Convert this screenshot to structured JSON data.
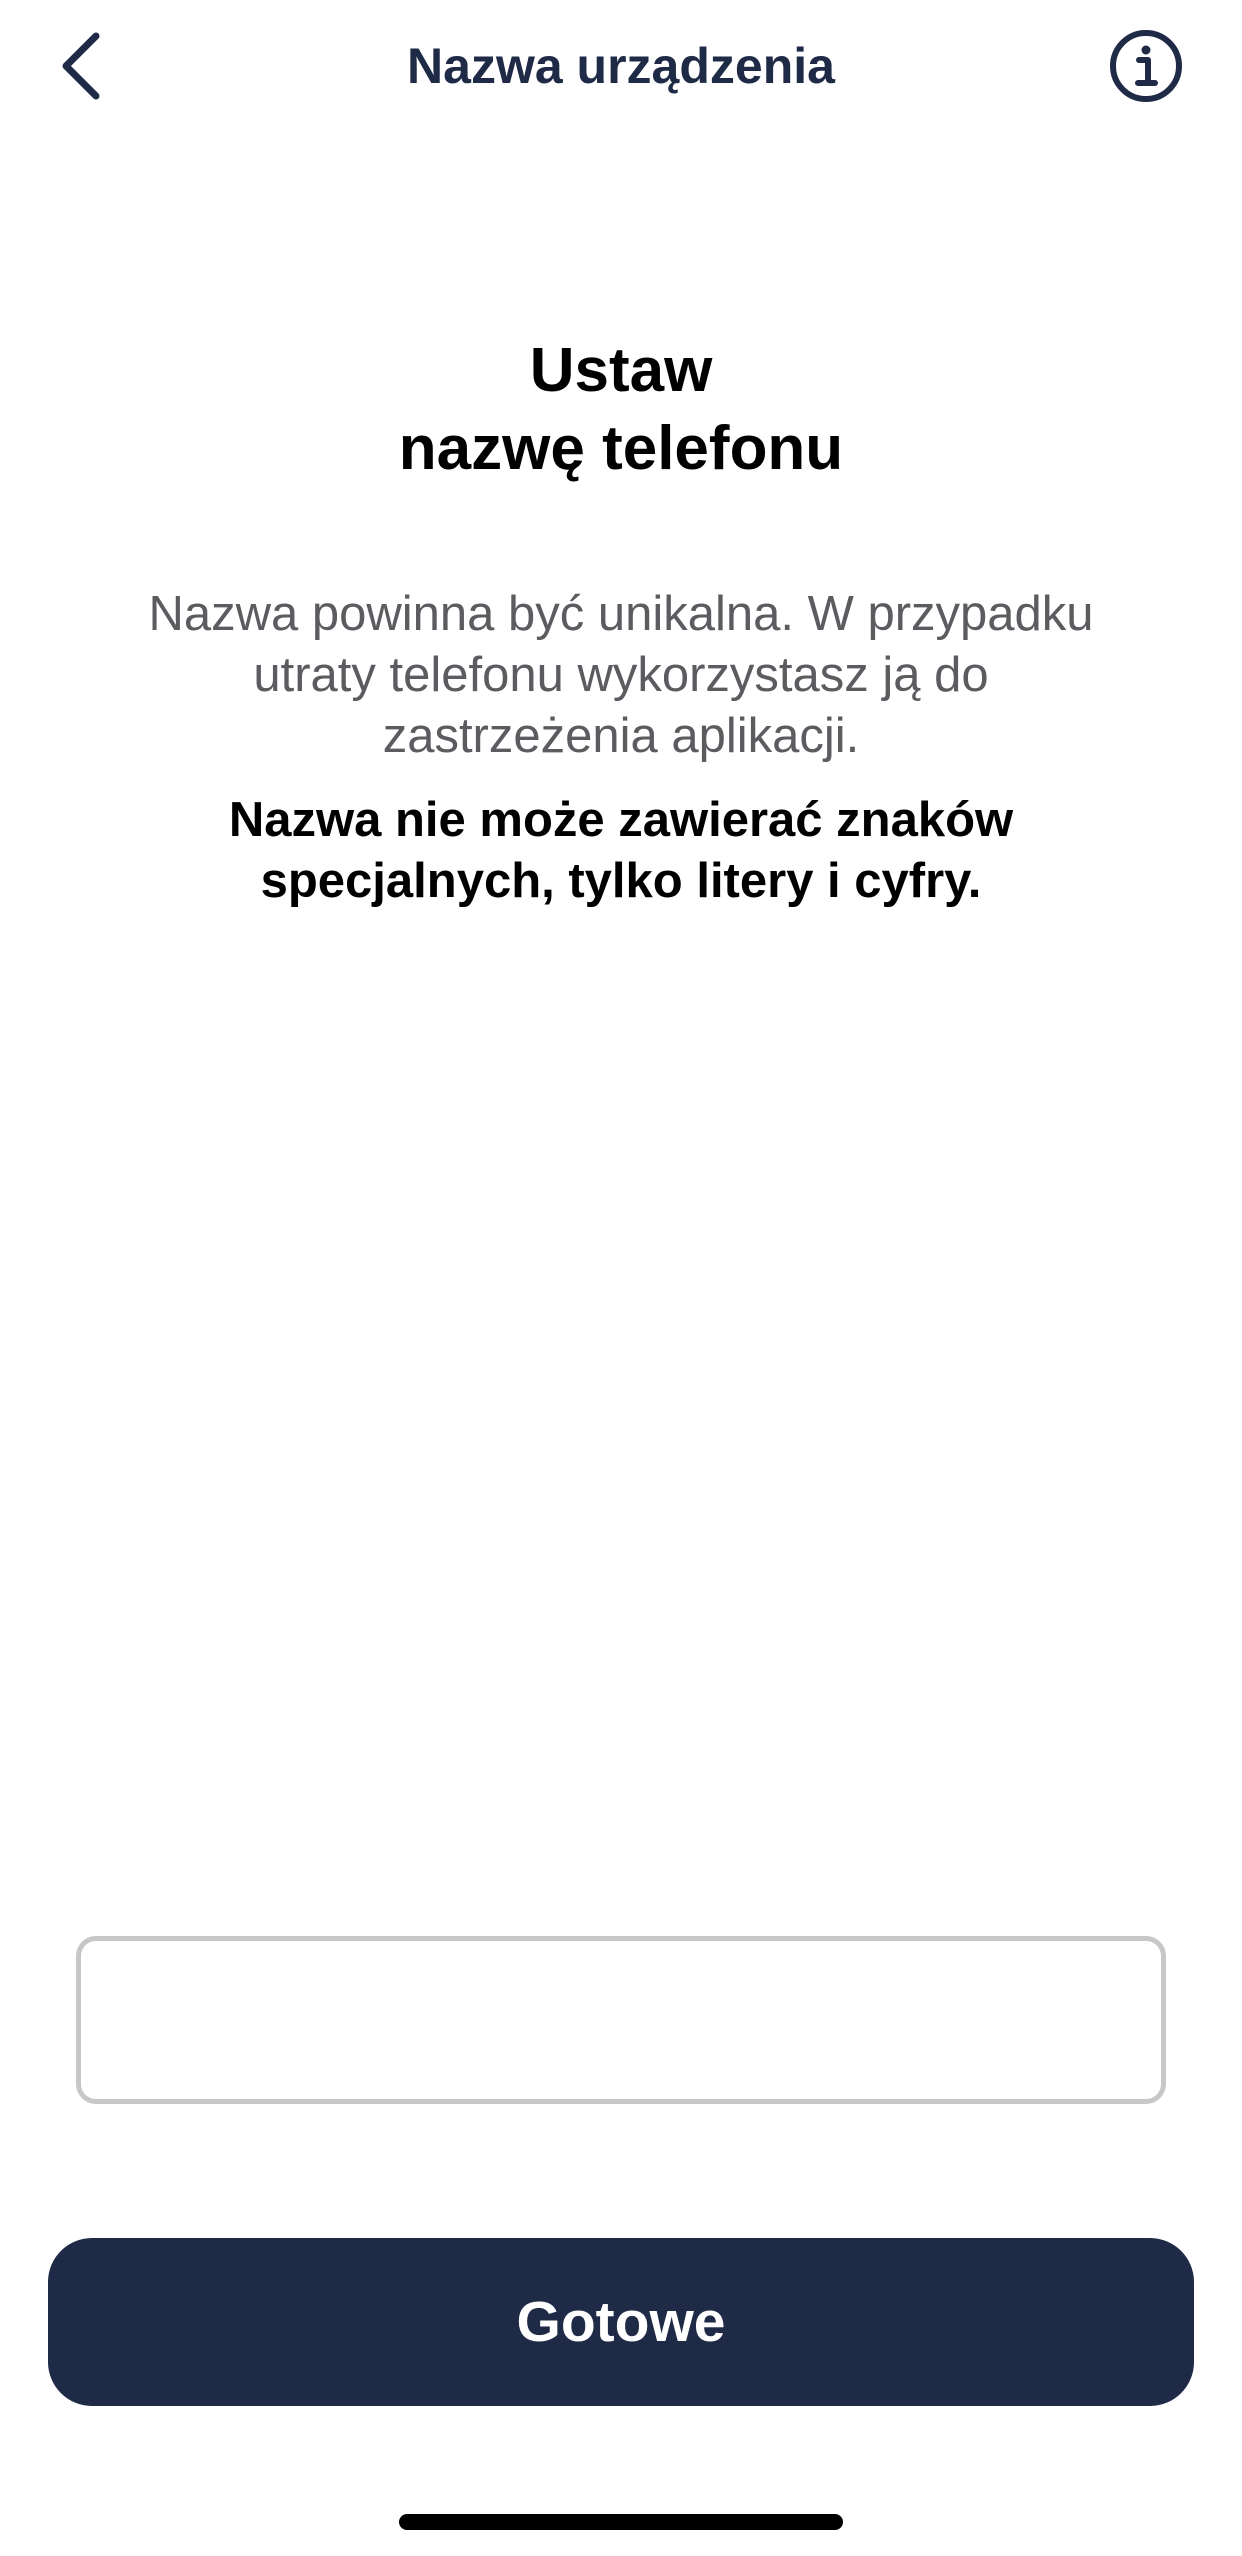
{
  "header": {
    "title": "Nazwa urządzenia",
    "back_icon": "chevron-left-icon",
    "info_icon": "info-circle-icon"
  },
  "main": {
    "heading_line1": "Ustaw",
    "heading_line2": "nazwę telefonu",
    "description": "Nazwa powinna być unikalna. W przypadku utraty telefonu wykorzystasz ją do zastrzeżenia aplikacji.",
    "warning": "Nazwa nie może zawierać znaków specjalnych, tylko litery i cyfry."
  },
  "form": {
    "device_name_value": "",
    "done_label": "Gotowe"
  },
  "colors": {
    "primary": "#1e2a46",
    "description_text": "#5b5b60",
    "input_border": "#c7c7c9",
    "background": "#ffffff"
  }
}
